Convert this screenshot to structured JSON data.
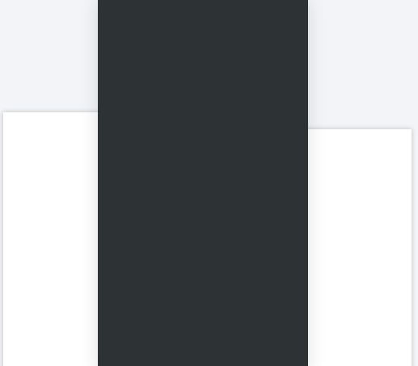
{
  "theme": {
    "page_background": "#f3f4f7",
    "card_background": "#ffffff",
    "panel_background": "#2d3235"
  },
  "left_card": {},
  "center_panel": {},
  "right_card": {}
}
